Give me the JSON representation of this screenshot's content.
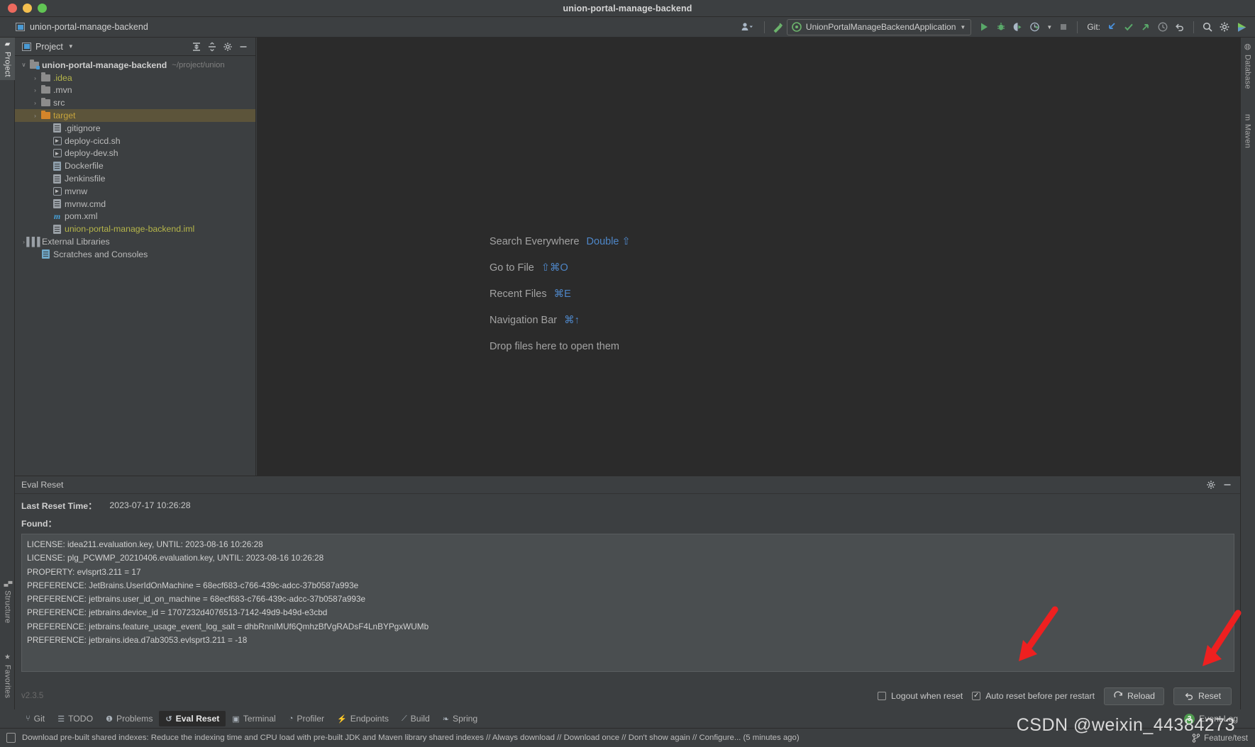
{
  "window": {
    "title": "union-portal-manage-backend",
    "project_tab_label": "union-portal-manage-backend"
  },
  "toolbar": {
    "run_config": "UnionPortalManageBackendApplication",
    "git_label": "Git:",
    "icons": {
      "profile": "user-icon",
      "build": "hammer-icon",
      "run": "run-icon",
      "debug": "debug-icon",
      "run_coverage": "coverage-icon",
      "profiler": "profiler-icon",
      "stop": "stop-icon",
      "update": "git-update-icon",
      "commit": "git-commit-icon",
      "push": "git-push-icon",
      "history": "history-icon",
      "rollback": "rollback-icon",
      "search": "search-icon",
      "settings": "gear-icon",
      "plugin": "plugin-icon"
    }
  },
  "left_strip": {
    "tabs": [
      {
        "label": "Project",
        "icon": "folder-icon",
        "active": true
      },
      {
        "label": "Structure",
        "icon": "structure-icon",
        "active": false
      },
      {
        "label": "Favorites",
        "icon": "star-icon",
        "active": false
      }
    ]
  },
  "right_strip": {
    "tabs": [
      {
        "label": "Database",
        "icon": "database-icon"
      },
      {
        "label": "Maven",
        "icon": "maven-icon"
      }
    ]
  },
  "project_panel": {
    "title": "Project",
    "actions": [
      "expand-all-icon",
      "collapse-all-icon",
      "gear-icon",
      "hide-icon"
    ],
    "tree": [
      {
        "indent": 0,
        "arrow": "∨",
        "icon": "folder-module",
        "label": "union-portal-manage-backend",
        "bold": true,
        "color": "#cfcfcf",
        "sub": "~/project/union",
        "selected": false
      },
      {
        "indent": 1,
        "arrow": "›",
        "icon": "folder",
        "label": ".idea",
        "bold": false,
        "color": "#b5b54a",
        "sub": "",
        "selected": false
      },
      {
        "indent": 1,
        "arrow": "›",
        "icon": "folder",
        "label": ".mvn",
        "bold": false,
        "color": "#bbbbbb",
        "sub": "",
        "selected": false
      },
      {
        "indent": 1,
        "arrow": "›",
        "icon": "folder",
        "label": "src",
        "bold": false,
        "color": "#bbbbbb",
        "sub": "",
        "selected": false
      },
      {
        "indent": 1,
        "arrow": "›",
        "icon": "folder-orange",
        "label": "target",
        "bold": false,
        "color": "#c8a43c",
        "sub": "",
        "selected": true
      },
      {
        "indent": 2,
        "arrow": "",
        "icon": "gitignore-file",
        "label": ".gitignore",
        "bold": false,
        "color": "#bbbbbb",
        "sub": "",
        "selected": false
      },
      {
        "indent": 2,
        "arrow": "",
        "icon": "shell-file",
        "label": "deploy-cicd.sh",
        "bold": false,
        "color": "#bbbbbb",
        "sub": "",
        "selected": false
      },
      {
        "indent": 2,
        "arrow": "",
        "icon": "shell-file",
        "label": "deploy-dev.sh",
        "bold": false,
        "color": "#bbbbbb",
        "sub": "",
        "selected": false
      },
      {
        "indent": 2,
        "arrow": "",
        "icon": "docker-file",
        "label": "Dockerfile",
        "bold": false,
        "color": "#bbbbbb",
        "sub": "",
        "selected": false
      },
      {
        "indent": 2,
        "arrow": "",
        "icon": "text-file",
        "label": "Jenkinsfile",
        "bold": false,
        "color": "#bbbbbb",
        "sub": "",
        "selected": false
      },
      {
        "indent": 2,
        "arrow": "",
        "icon": "shell-file",
        "label": "mvnw",
        "bold": false,
        "color": "#bbbbbb",
        "sub": "",
        "selected": false
      },
      {
        "indent": 2,
        "arrow": "",
        "icon": "text-file",
        "label": "mvnw.cmd",
        "bold": false,
        "color": "#bbbbbb",
        "sub": "",
        "selected": false
      },
      {
        "indent": 2,
        "arrow": "",
        "icon": "maven-file",
        "label": "pom.xml",
        "bold": false,
        "color": "#bbbbbb",
        "sub": "",
        "selected": false
      },
      {
        "indent": 2,
        "arrow": "",
        "icon": "iml-file",
        "label": "union-portal-manage-backend.iml",
        "bold": false,
        "color": "#b5b54a",
        "sub": "",
        "selected": false
      },
      {
        "indent": 0,
        "arrow": "›",
        "icon": "library-icon",
        "label": "External Libraries",
        "bold": false,
        "color": "#bbbbbb",
        "sub": "",
        "selected": false
      },
      {
        "indent": 1,
        "arrow": "",
        "icon": "scratches-icon",
        "label": "Scratches and Consoles",
        "bold": false,
        "color": "#bbbbbb",
        "sub": "",
        "selected": false
      }
    ]
  },
  "editor": {
    "hints": [
      {
        "label": "Search Everywhere",
        "key": "Double ⇧"
      },
      {
        "label": "Go to File",
        "key": "⇧⌘O"
      },
      {
        "label": "Recent Files",
        "key": "⌘E"
      },
      {
        "label": "Navigation Bar",
        "key": "⌘↑"
      }
    ],
    "drop_hint": "Drop files here to open them"
  },
  "eval_reset": {
    "panel_title": "Eval Reset",
    "last_reset_label": "Last Reset Time：",
    "last_reset_value": "2023-07-17 10:26:28",
    "found_label": "Found：",
    "log_lines": [
      "LICENSE: idea211.evaluation.key, UNTIL: 2023-08-16 10:26:28",
      "LICENSE: plg_PCWMP_20210406.evaluation.key, UNTIL: 2023-08-16 10:26:28",
      "PROPERTY: evlsprt3.211 = 17",
      "PREFERENCE: JetBrains.UserIdOnMachine = 68ecf683-c766-439c-adcc-37b0587a993e",
      "PREFERENCE: jetbrains.user_id_on_machine = 68ecf683-c766-439c-adcc-37b0587a993e",
      "PREFERENCE: jetbrains.device_id = 1707232d4076513-7142-49d9-b49d-e3cbd",
      "PREFERENCE: jetbrains.feature_usage_event_log_salt = dhbRnnIMUf6QmhzBfVgRADsF4LnBYPgxWUMb",
      "PREFERENCE: jetbrains.idea.d7ab3053.evlsprt3.211 = -18"
    ],
    "version": "v2.3.5",
    "checkbox_logout": {
      "label": "Logout when reset",
      "checked": false
    },
    "checkbox_autoreset": {
      "label": "Auto reset before per restart",
      "checked": true
    },
    "reload_button": "Reload",
    "reset_button": "Reset"
  },
  "bottom_tabs": [
    {
      "label": "Git",
      "icon": "git-icon",
      "active": false
    },
    {
      "label": "TODO",
      "icon": "todo-icon",
      "active": false
    },
    {
      "label": "Problems",
      "icon": "problems-icon",
      "active": false
    },
    {
      "label": "Eval Reset",
      "icon": "reset-icon",
      "active": true
    },
    {
      "label": "Terminal",
      "icon": "terminal-icon",
      "active": false
    },
    {
      "label": "Profiler",
      "icon": "profiler-icon",
      "active": false
    },
    {
      "label": "Endpoints",
      "icon": "endpoints-icon",
      "active": false
    },
    {
      "label": "Build",
      "icon": "hammer-icon",
      "active": false
    },
    {
      "label": "Spring",
      "icon": "spring-icon",
      "active": false
    }
  ],
  "event_log": {
    "label": "Event Log",
    "count": "3"
  },
  "status_bar": {
    "message": "Download pre-built shared indexes: Reduce the indexing time and CPU load with pre-built JDK and Maven library shared indexes // Always download // Download once // Don't show again // Configure... (5 minutes ago)",
    "branch": "Feature/test"
  },
  "watermark": "CSDN @weixin_44384273",
  "colors": {
    "background": "#3c3f41",
    "editor_background": "#2b2b2b",
    "accent_blue": "#4e86c7",
    "selection": "#5c543a",
    "green_run": "#59a869",
    "annotation_red": "#ef2929"
  }
}
